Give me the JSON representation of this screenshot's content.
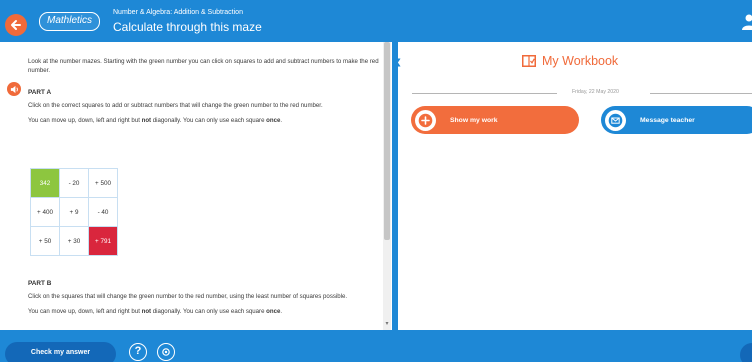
{
  "header": {
    "brand": "Mathletics",
    "subtitle": "Number & Algebra: Addition & Subtraction",
    "title": "Calculate through this maze"
  },
  "question": {
    "intro": "Look at the number mazes. Starting with the green number you can click on squares to add and subtract numbers to make the red number.",
    "part_a": {
      "heading": "PART A",
      "instruction": "Click on the correct squares to add or subtract numbers that will change the green number to the red number.",
      "rule_prefix": "You can move up, down, left and right but ",
      "rule_not": "not",
      "rule_middle": " diagonally. You can only use each square ",
      "rule_once": "once",
      "rule_end": "."
    },
    "grid": [
      [
        "342",
        "- 20",
        "+ 500"
      ],
      [
        "+ 400",
        "+ 9",
        "- 40"
      ],
      [
        "+ 50",
        "+ 30",
        "+ 791"
      ]
    ],
    "grid_colors": {
      "start": "#8dc63f",
      "target": "#d9263d"
    },
    "part_b": {
      "heading": "PART B",
      "instruction": "Click on the squares that will change the green number to the red number, using the least number of squares possible.",
      "rule_prefix": "You can move up, down, left and right but ",
      "rule_not": "not",
      "rule_middle": " diagonally. You can only use each square ",
      "rule_once": "once",
      "rule_end": "."
    }
  },
  "workbook": {
    "title": "My Workbook",
    "date": "Friday, 22 May 2020",
    "show_work_label": "Show my work",
    "message_teacher_label": "Message teacher"
  },
  "footer": {
    "check_answer_label": "Check my answer",
    "help_label": "?"
  },
  "colors": {
    "primary_blue": "#1e88d6",
    "accent_orange": "#f06a3a"
  },
  "icons": {
    "back": "back-arrow-icon",
    "user": "user-icon",
    "sound": "speaker-icon",
    "collapse": "double-chevron-left-icon",
    "workbook": "workbook-icon",
    "show_work": "plus-icon",
    "message": "envelope-icon",
    "help": "help-icon",
    "audio": "audio-icon"
  }
}
